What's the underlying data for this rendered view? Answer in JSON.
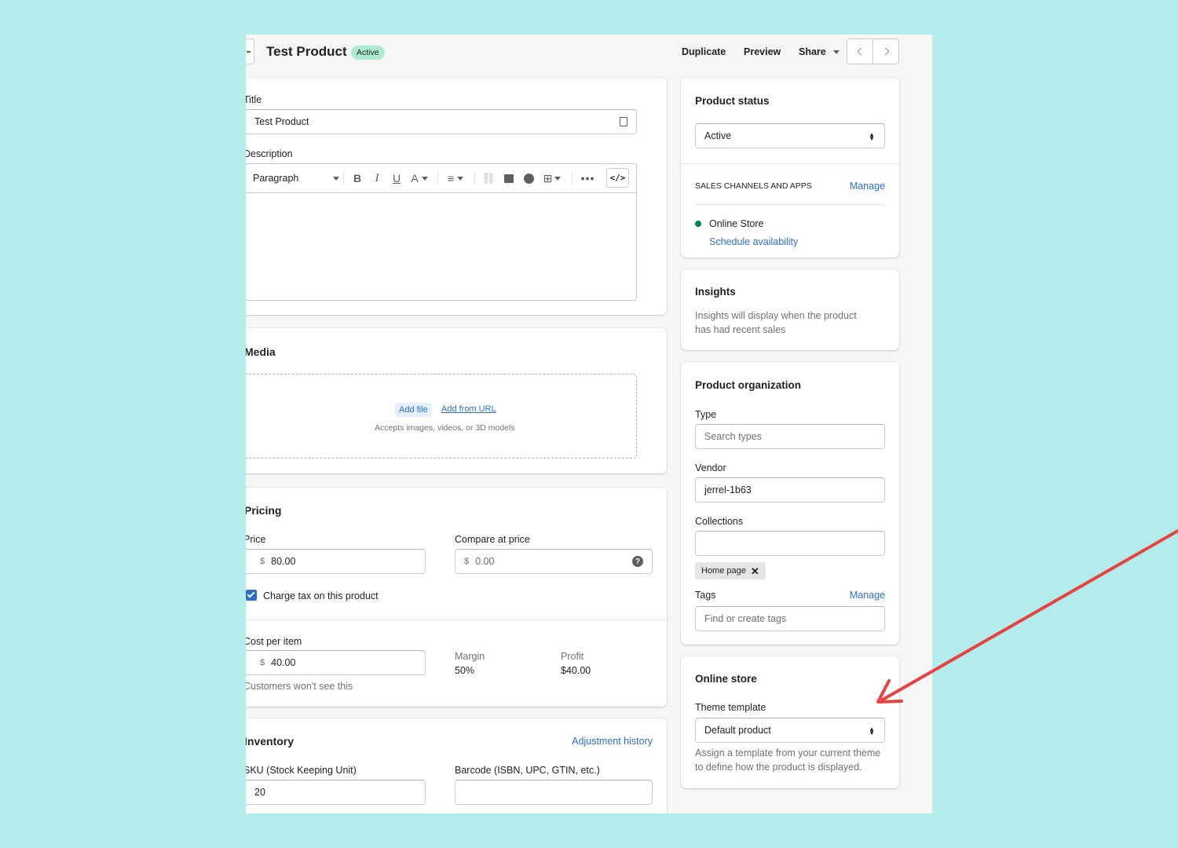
{
  "header": {
    "title": "Test Product",
    "status_badge": "Active",
    "duplicate_label": "Duplicate",
    "preview_label": "Preview",
    "share_label": "Share"
  },
  "main": {
    "title_label": "Title",
    "title_value": "Test Product",
    "description_label": "Description",
    "editor": {
      "paragraph_label": "Paragraph"
    },
    "media": {
      "heading": "Media",
      "add_file": "Add file",
      "add_from_url": "Add from URL",
      "hint": "Accepts images, videos, or 3D models"
    },
    "pricing": {
      "heading": "Pricing",
      "price_label": "Price",
      "currency": "$",
      "price_value": "80.00",
      "compare_label": "Compare at price",
      "compare_placeholder": "0.00",
      "charge_tax_label": "Charge tax on this product",
      "cost_label": "Cost per item",
      "cost_value": "40.00",
      "cost_hint": "Customers won't see this",
      "margin_label": "Margin",
      "margin_value": "50%",
      "profit_label": "Profit",
      "profit_value": "$40.00"
    },
    "inventory": {
      "heading": "Inventory",
      "adjustment_history": "Adjustment history",
      "sku_label": "SKU (Stock Keeping Unit)",
      "sku_value": "20",
      "barcode_label": "Barcode (ISBN, UPC, GTIN, etc.)",
      "barcode_value": ""
    }
  },
  "sidebar": {
    "status": {
      "heading": "Product status",
      "value": "Active",
      "sales_channels_label": "SALES CHANNELS AND APPS",
      "manage": "Manage",
      "channel": "Online Store",
      "schedule": "Schedule availability"
    },
    "insights": {
      "heading": "Insights",
      "text_line1": "Insights will display when the product",
      "text_line2": "has had recent sales"
    },
    "organization": {
      "heading": "Product organization",
      "type_label": "Type",
      "type_placeholder": "Search types",
      "vendor_label": "Vendor",
      "vendor_value": "jerrel-1b63",
      "collections_label": "Collections",
      "collection_tag": "Home page",
      "tags_label": "Tags",
      "tags_manage": "Manage",
      "tags_placeholder": "Find or create tags"
    },
    "online_store": {
      "heading": "Online store",
      "template_label": "Theme template",
      "template_value": "Default product",
      "hint_line1": "Assign a template from your current theme",
      "hint_line2": "to define how the product is displayed."
    }
  },
  "colors": {
    "background": "#b3eceb",
    "badge_bg": "#aee9d1",
    "link": "#2c6ecb",
    "checkbox": "#2c6ecb",
    "channel_dot": "#007f5f",
    "arrow": "#e84141"
  }
}
